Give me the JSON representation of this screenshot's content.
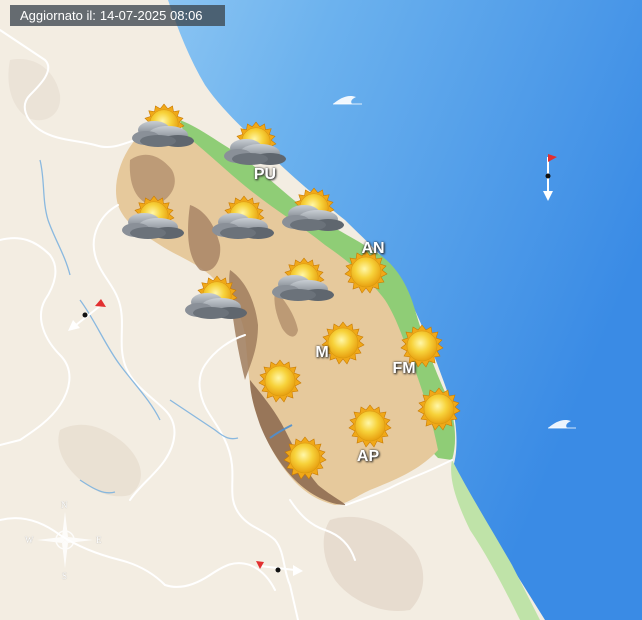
{
  "header": {
    "label": "Aggiornato il:",
    "datetime": "14-07-2025 08:06"
  },
  "provinces": [
    {
      "code": "PU"
    },
    {
      "code": "AN"
    },
    {
      "code": "M"
    },
    {
      "code": "FM"
    },
    {
      "code": "AP"
    }
  ],
  "forecast_icons": [
    {
      "type": "cloudy-sun-icon",
      "province": "PU"
    },
    {
      "type": "cloudy-sun-icon",
      "province": "PU"
    },
    {
      "type": "cloudy-sun-icon",
      "province": "PU"
    },
    {
      "type": "cloudy-sun-icon",
      "province": "PU"
    },
    {
      "type": "cloudy-sun-icon",
      "province": "AN"
    },
    {
      "type": "cloudy-sun-icon",
      "province": "M"
    },
    {
      "type": "cloudy-sun-icon",
      "province": "M"
    },
    {
      "type": "sun-icon",
      "province": "AN"
    },
    {
      "type": "sun-icon",
      "province": "M"
    },
    {
      "type": "sun-icon",
      "province": "FM"
    },
    {
      "type": "sun-icon",
      "province": "M"
    },
    {
      "type": "sun-icon",
      "province": "FM"
    },
    {
      "type": "sun-icon",
      "province": "AP"
    },
    {
      "type": "sun-icon",
      "province": "AP"
    }
  ],
  "compass": {
    "n": "N",
    "s": "S",
    "e": "E",
    "w": "W"
  },
  "colors": {
    "sea_light": "#9fd0f5",
    "sea_deep": "#3e8fe6",
    "coast_green": "#8ccb73",
    "region_fill": "#e5c79b",
    "mountain": "#9b7a5e",
    "land": "#f6efe4",
    "border": "#ffffff",
    "river": "#6aa7d8"
  },
  "wind_markers": [
    {
      "type": "wind-arrow-icon",
      "direction": "south"
    },
    {
      "type": "wind-arrow-icon",
      "direction": "south-west"
    },
    {
      "type": "wind-arrow-icon",
      "direction": "east"
    }
  ],
  "wave_markers": [
    {
      "type": "wave-icon"
    },
    {
      "type": "wave-icon"
    }
  ]
}
